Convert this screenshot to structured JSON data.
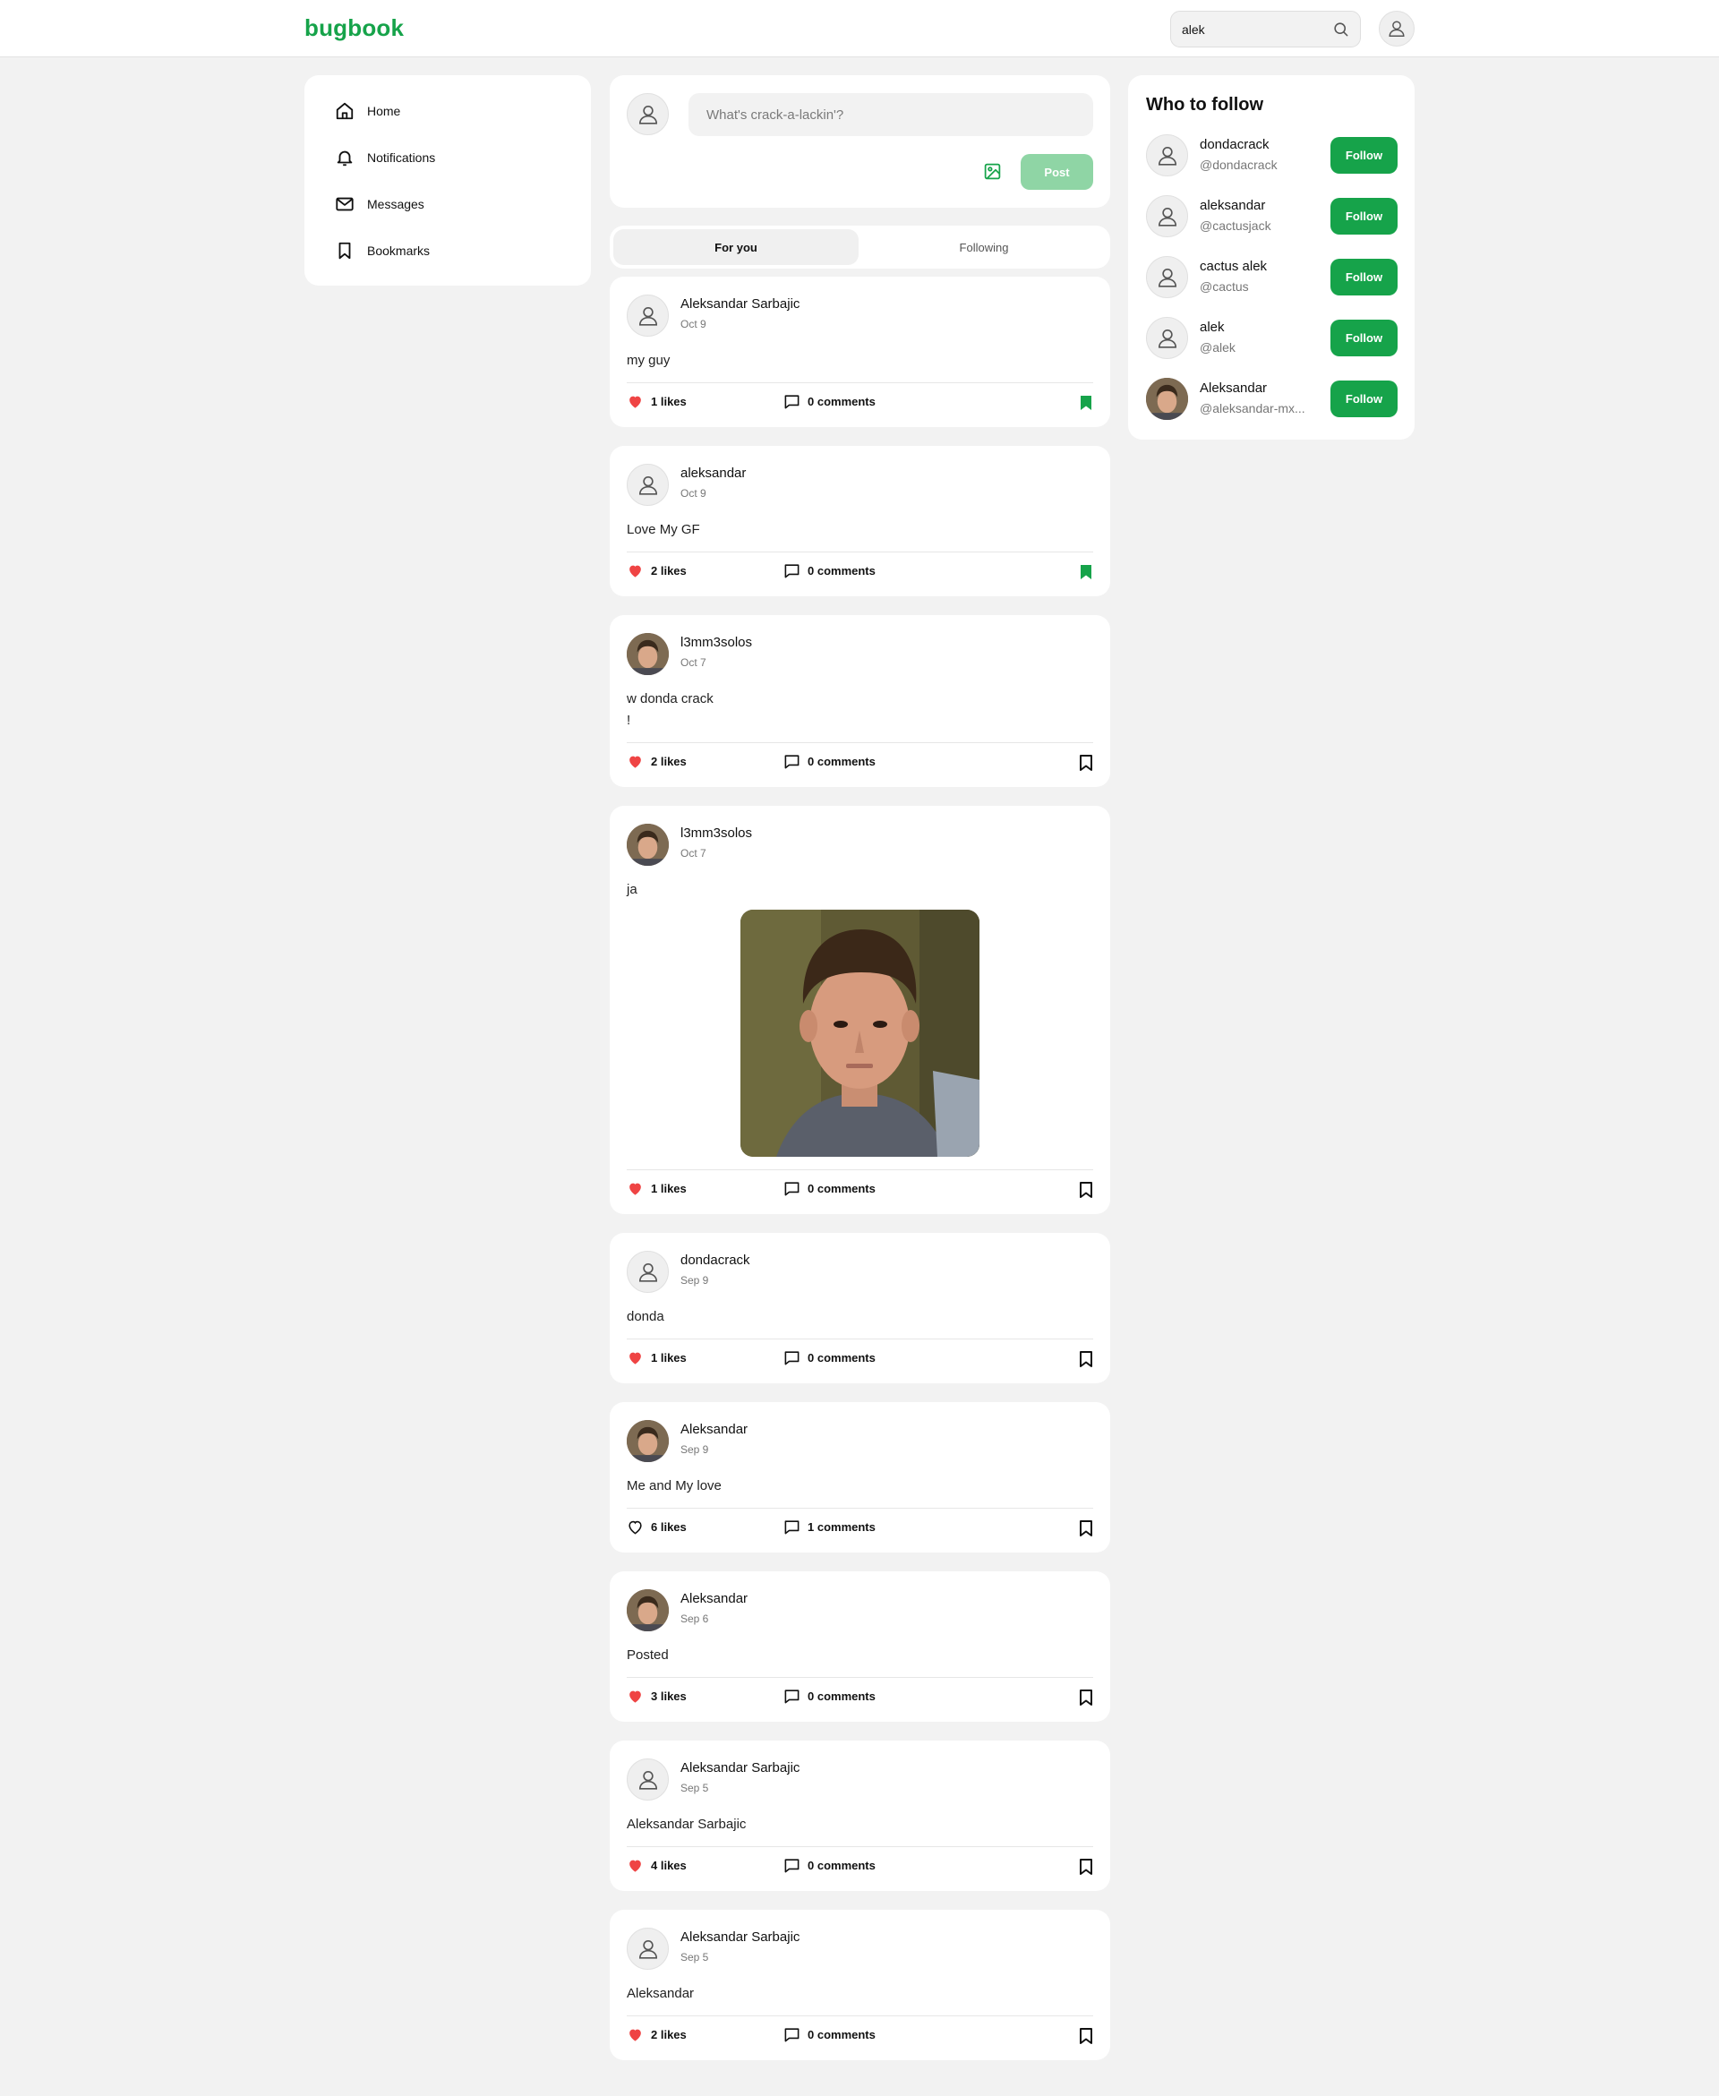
{
  "header": {
    "logo": "bugbook",
    "search_value": "alek"
  },
  "nav": {
    "items": [
      {
        "label": "Home",
        "icon": "home-icon"
      },
      {
        "label": "Notifications",
        "icon": "bell-icon"
      },
      {
        "label": "Messages",
        "icon": "mail-icon"
      },
      {
        "label": "Bookmarks",
        "icon": "bookmark-icon"
      }
    ]
  },
  "composer": {
    "placeholder": "What's crack-a-lackin'?",
    "post_label": "Post"
  },
  "tabs": [
    {
      "label": "For you",
      "active": true
    },
    {
      "label": "Following",
      "active": false
    }
  ],
  "posts": [
    {
      "author": "Aleksandar Sarbajic",
      "date": "Oct 9",
      "content": "my guy",
      "likes": "1 likes",
      "comments": "0 comments",
      "liked": true,
      "bookmarked": true,
      "avatar": "placeholder"
    },
    {
      "author": "aleksandar",
      "date": "Oct 9",
      "content": "Love My GF",
      "likes": "2 likes",
      "comments": "0 comments",
      "liked": true,
      "bookmarked": true,
      "avatar": "placeholder"
    },
    {
      "author": "l3mm3solos",
      "date": "Oct 7",
      "content": "w donda crack\n!",
      "likes": "2 likes",
      "comments": "0 comments",
      "liked": true,
      "bookmarked": false,
      "avatar": "photo"
    },
    {
      "author": "l3mm3solos",
      "date": "Oct 7",
      "content": "ja",
      "likes": "1 likes",
      "comments": "0 comments",
      "liked": true,
      "bookmarked": false,
      "avatar": "photo",
      "has_image": true
    },
    {
      "author": "dondacrack",
      "date": "Sep 9",
      "content": "donda",
      "likes": "1 likes",
      "comments": "0 comments",
      "liked": true,
      "bookmarked": false,
      "avatar": "placeholder"
    },
    {
      "author": "Aleksandar",
      "date": "Sep 9",
      "content": "Me and My love",
      "likes": "6 likes",
      "comments": "1 comments",
      "liked": false,
      "bookmarked": false,
      "avatar": "photo"
    },
    {
      "author": "Aleksandar",
      "date": "Sep 6",
      "content": "Posted",
      "likes": "3 likes",
      "comments": "0 comments",
      "liked": true,
      "bookmarked": false,
      "avatar": "photo"
    },
    {
      "author": "Aleksandar Sarbajic",
      "date": "Sep 5",
      "content": "Aleksandar Sarbajic",
      "likes": "4 likes",
      "comments": "0 comments",
      "liked": true,
      "bookmarked": false,
      "avatar": "placeholder"
    },
    {
      "author": "Aleksandar Sarbajic",
      "date": "Sep 5",
      "content": "Aleksandar",
      "likes": "2 likes",
      "comments": "0 comments",
      "liked": true,
      "bookmarked": false,
      "avatar": "placeholder"
    }
  ],
  "who_to_follow": {
    "title": "Who to follow",
    "button_label": "Follow",
    "users": [
      {
        "name": "dondacrack",
        "handle": "@dondacrack",
        "avatar": "placeholder"
      },
      {
        "name": "aleksandar",
        "handle": "@cactusjack",
        "avatar": "placeholder"
      },
      {
        "name": "cactus alek",
        "handle": "@cactus",
        "avatar": "placeholder"
      },
      {
        "name": "alek",
        "handle": "@alek",
        "avatar": "placeholder"
      },
      {
        "name": "Aleksandar",
        "handle": "@aleksandar-mx...",
        "avatar": "photo"
      }
    ]
  },
  "colors": {
    "brand": "#16a34a",
    "brand_light": "#8fd5a5",
    "like": "#ef4444",
    "background": "#f2f2f2"
  }
}
